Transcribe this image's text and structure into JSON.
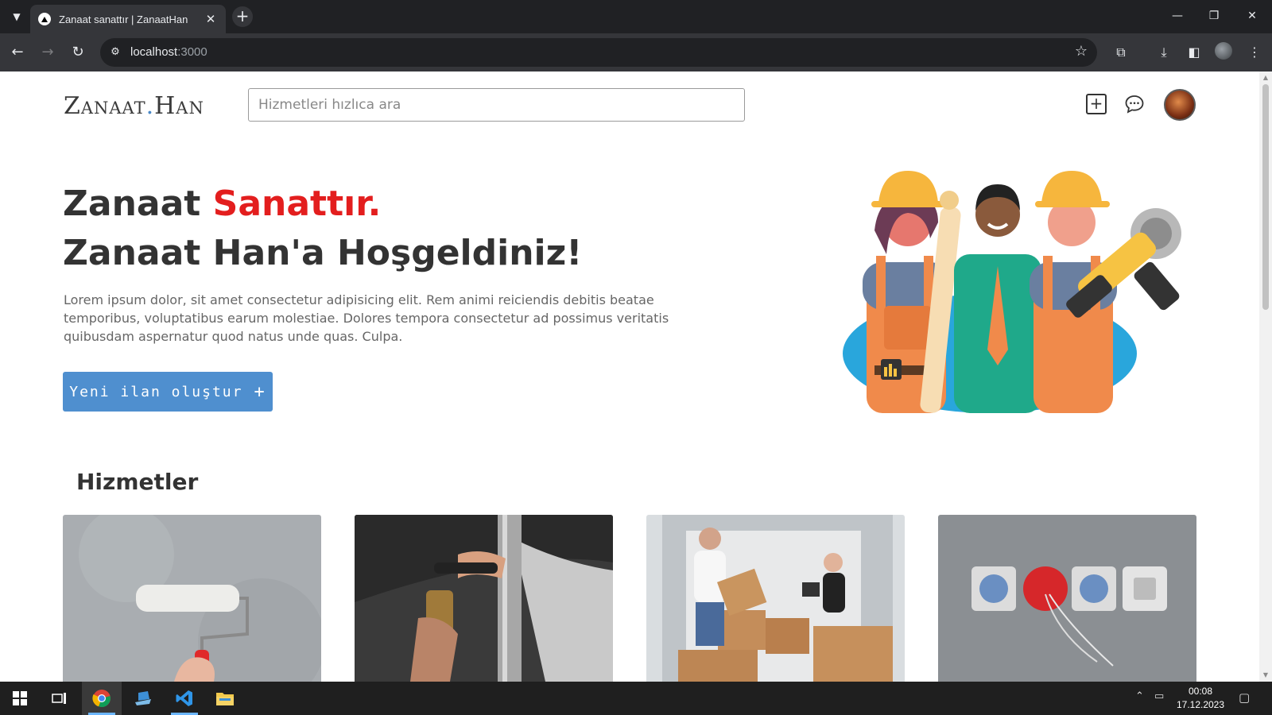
{
  "browser": {
    "tab_title": "Zanaat sanattır | ZanaatHan",
    "tab_close": "✕",
    "new_tab": "+",
    "url_host": "localhost",
    "url_port": ":3000"
  },
  "header": {
    "logo_main": "Zanaat",
    "logo_dot": ".",
    "logo_end": "Han",
    "search_placeholder": "Hizmetleri hızlıca ara"
  },
  "hero": {
    "title_part1": "Zanaat ",
    "title_accent": "Sanattır.",
    "title_line2": "Zanaat Han'a Hoşgeldiniz!",
    "description": "Lorem ipsum dolor, sit amet consectetur adipisicing elit. Rem animi reiciendis debitis beatae temporibus, voluptatibus earum molestiae. Dolores tempora consectetur ad possimus veritatis quibusdam aspernatur quod natus unde quas. Culpa.",
    "cta_label": "Yeni ilan oluştur",
    "cta_icon": "+"
  },
  "services": {
    "title": "Hizmetler",
    "cards": [
      {
        "name": "painting"
      },
      {
        "name": "plumbing"
      },
      {
        "name": "moving"
      },
      {
        "name": "electrical"
      }
    ]
  },
  "taskbar": {
    "time": "00:08",
    "date": "17.12.2023"
  },
  "colors": {
    "accent_red": "#e31e1e",
    "cta_blue": "#4f8fcf",
    "logo_dot": "#4a88c7"
  }
}
